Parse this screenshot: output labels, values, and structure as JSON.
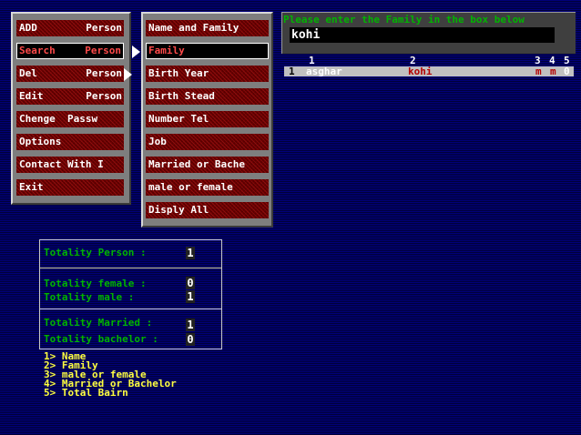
{
  "main_menu": [
    {
      "label_left": "ADD",
      "label_right": "Person",
      "selected": false
    },
    {
      "label_left": "Search",
      "label_right": "Person",
      "selected": true
    },
    {
      "label_left": "Del",
      "label_right": "Person",
      "selected": false
    },
    {
      "label_left": "Edit",
      "label_right": "Person",
      "selected": false
    },
    {
      "label_left": "Chenge  Passw",
      "label_right": "",
      "selected": false
    },
    {
      "label_left": "Options",
      "label_right": "",
      "selected": false
    },
    {
      "label_left": "Contact With I",
      "label_right": "",
      "selected": false
    },
    {
      "label_left": "Exit",
      "label_right": "",
      "selected": false
    }
  ],
  "search_menu": [
    {
      "label": "Name and Family",
      "selected": false
    },
    {
      "label": "Family",
      "selected": true
    },
    {
      "label": "Birth Year",
      "selected": false
    },
    {
      "label": "Birth Stead",
      "selected": false
    },
    {
      "label": "Number Tel",
      "selected": false
    },
    {
      "label": "Job",
      "selected": false
    },
    {
      "label": "Married or Bache",
      "selected": false
    },
    {
      "label": "male or female",
      "selected": false
    },
    {
      "label": "Disply All",
      "selected": false
    }
  ],
  "search": {
    "prompt": "Please enter the Family in the box below",
    "value": "kohi"
  },
  "results": {
    "columns": [
      "1",
      "2",
      "3",
      "4",
      "5"
    ],
    "rows": [
      {
        "num": "1",
        "name": "asghar",
        "family": "kohi",
        "c3": "m",
        "c4": "m",
        "c5": "0"
      }
    ]
  },
  "stats": {
    "totality_person_label": "Totality Person :",
    "totality_person_value": "1",
    "totality_female_label": "Totality female :",
    "totality_female_value": "0",
    "totality_male_label": "Totality male :",
    "totality_male_value": "1",
    "totality_married_label": "Totality Married :",
    "totality_married_value": "1",
    "totality_bachelor_label": "Totality bachelor :",
    "totality_bachelor_value": "0"
  },
  "legend": [
    "1> Name",
    "2> Family",
    "3> male or female",
    "4> Married or Bachelor",
    "5> Total Bairn"
  ],
  "colors": {
    "background": "#00007a",
    "prompt_green": "#00b400",
    "legend_yellow": "#ffff40",
    "menu_red": "#5a0000",
    "selected_text_red": "#ff4a4a"
  }
}
